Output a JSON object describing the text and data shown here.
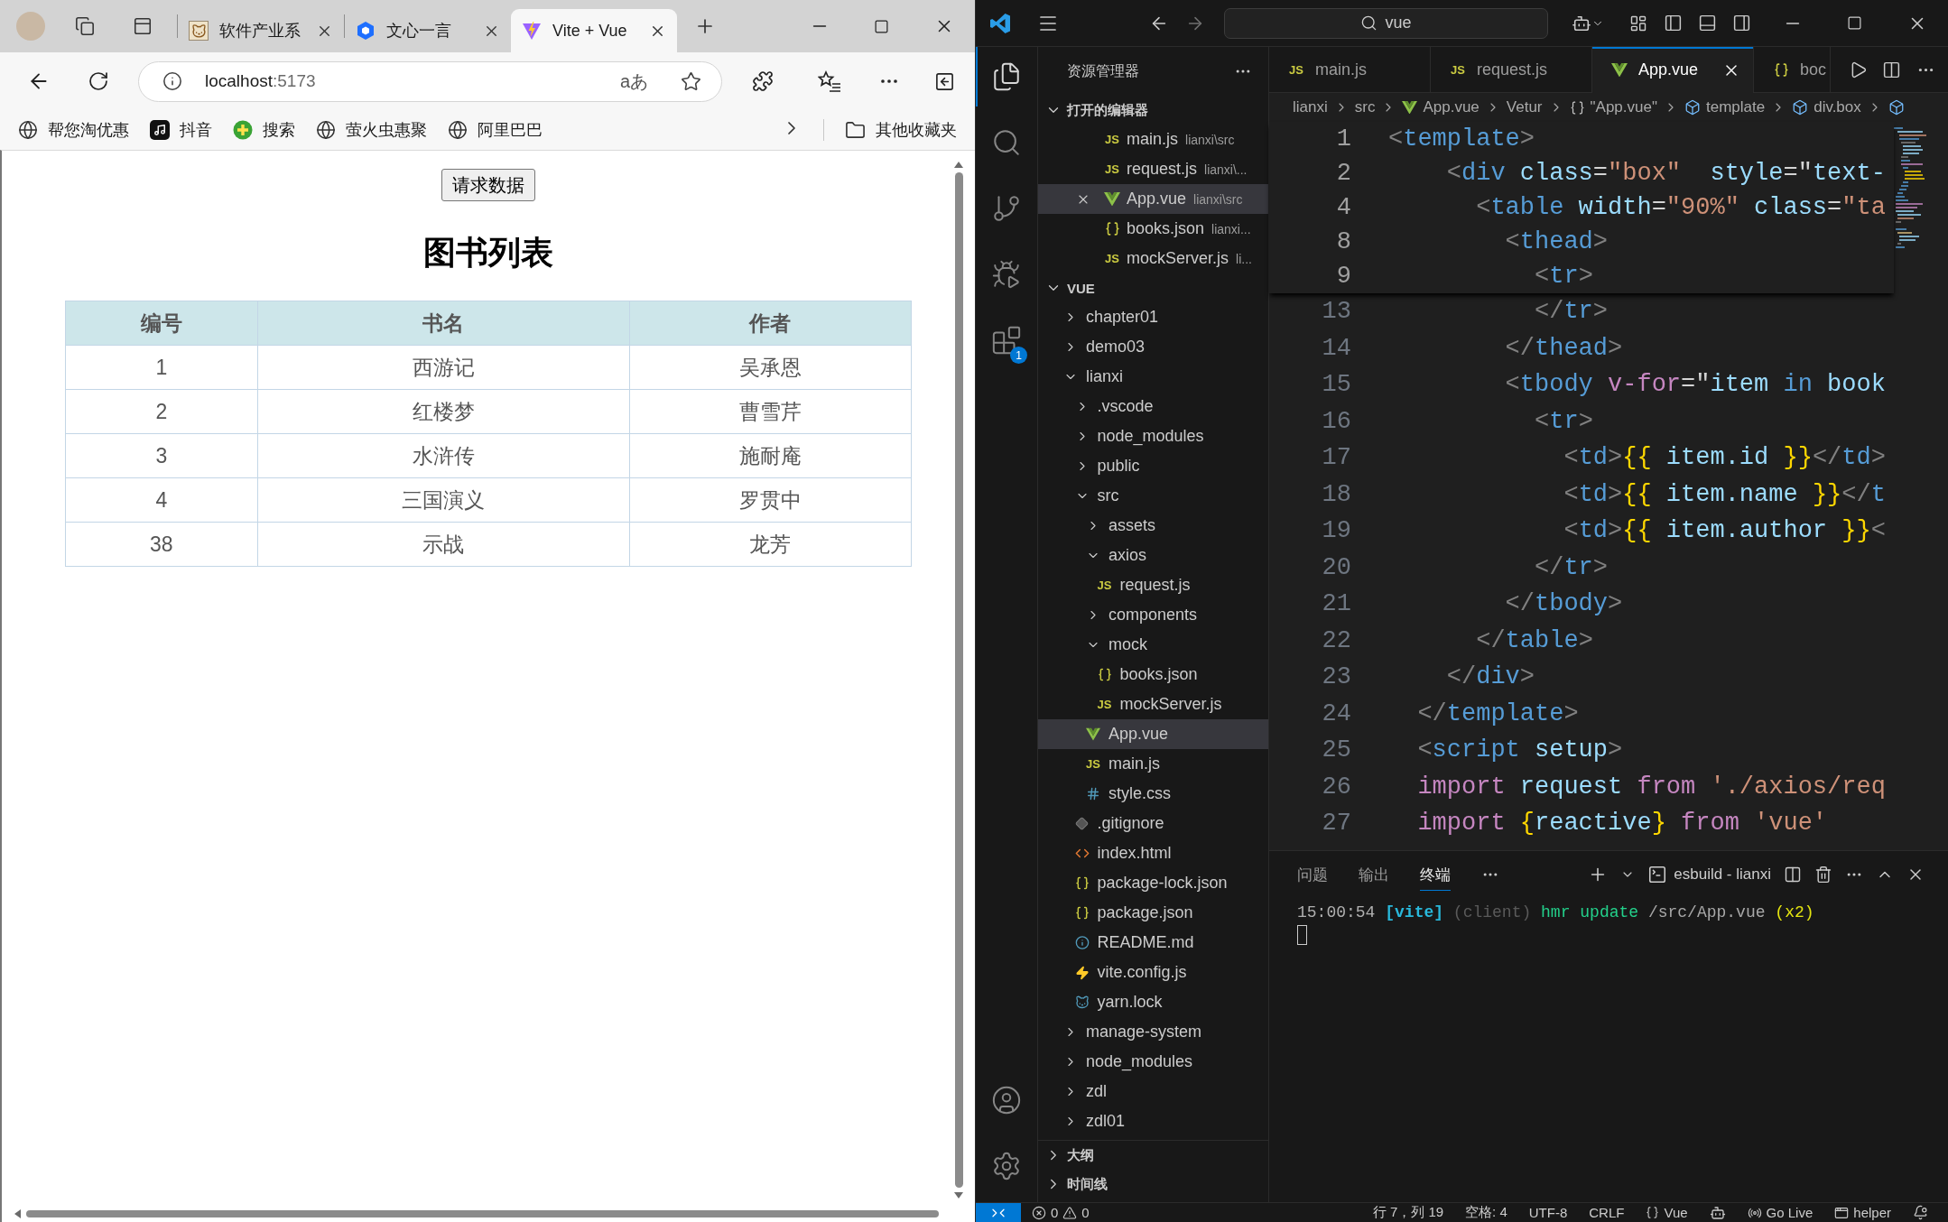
{
  "browser": {
    "tabs": [
      {
        "title": "软件产业系",
        "kind": "cat",
        "selected": false
      },
      {
        "title": "文心一言",
        "kind": "hexagon",
        "selected": false
      },
      {
        "title": "Vite + Vue",
        "kind": "bolt",
        "selected": true
      }
    ],
    "address": {
      "host": "localhost",
      "port": ":5173"
    },
    "reader": "aあ",
    "bookmarks": [
      {
        "label": "帮您淘优惠",
        "kind": "globe"
      },
      {
        "label": "抖音",
        "kind": "note"
      },
      {
        "label": "搜索",
        "kind": "plus"
      },
      {
        "label": "萤火虫惠聚",
        "kind": "globe"
      },
      {
        "label": "阿里巴巴",
        "kind": "globe"
      }
    ],
    "other_bookmarks": "其他收藏夹"
  },
  "page": {
    "button": "请求数据",
    "title": "图书列表",
    "table": {
      "columns": [
        "编号",
        "书名",
        "作者"
      ],
      "rows": [
        [
          "1",
          "西游记",
          "吴承恩"
        ],
        [
          "2",
          "红楼梦",
          "曹雪芹"
        ],
        [
          "3",
          "水浒传",
          "施耐庵"
        ],
        [
          "4",
          "三国演义",
          "罗贯中"
        ],
        [
          "38",
          "示战",
          "龙芳"
        ]
      ]
    }
  },
  "vscode": {
    "search": "vue",
    "activity": [
      {
        "kind": "explorer",
        "selected": true
      },
      {
        "kind": "search",
        "selected": false
      },
      {
        "kind": "source_control",
        "selected": false
      },
      {
        "kind": "run",
        "selected": false
      },
      {
        "kind": "extensions",
        "selected": false,
        "badge": "1"
      }
    ],
    "explorer": {
      "title": "资源管理器",
      "open_editors": {
        "title": "打开的编辑器",
        "expanded": true,
        "items": [
          {
            "name": "main.js",
            "path": "lianxi\\src",
            "kind": "js",
            "icon_text": "JS",
            "selected": false
          },
          {
            "name": "request.js",
            "path": "lianxi\\...",
            "kind": "js",
            "icon_text": "JS",
            "selected": false
          },
          {
            "name": "App.vue",
            "path": "lianxi\\src",
            "kind": "vue",
            "selected": true
          },
          {
            "name": "books.json",
            "path": "lianxi...",
            "kind": "json",
            "selected": false
          },
          {
            "name": "mockServer.js",
            "path": "li...",
            "kind": "js",
            "icon_text": "JS",
            "selected": false
          }
        ]
      },
      "folder": {
        "title": "VUE",
        "expanded": true,
        "children": [
          {
            "name": "chapter01",
            "kind": "folder",
            "expanded": false,
            "selected": false
          },
          {
            "name": "demo03",
            "kind": "folder",
            "expanded": false,
            "selected": false
          },
          {
            "name": "lianxi",
            "kind": "folder",
            "expanded": true,
            "selected": false,
            "children": [
              {
                "name": ".vscode",
                "kind": "folder",
                "expanded": false,
                "selected": false
              },
              {
                "name": "node_modules",
                "kind": "folder",
                "expanded": false,
                "selected": false
              },
              {
                "name": "public",
                "kind": "folder",
                "expanded": false,
                "selected": false
              },
              {
                "name": "src",
                "kind": "folder",
                "expanded": true,
                "selected": false,
                "children": [
                  {
                    "name": "assets",
                    "kind": "folder",
                    "expanded": false,
                    "selected": false
                  },
                  {
                    "name": "axios",
                    "kind": "folder",
                    "expanded": true,
                    "selected": false,
                    "children": [
                      {
                        "name": "request.js",
                        "kind": "js",
                        "icon_text": "JS",
                        "selected": false
                      }
                    ]
                  },
                  {
                    "name": "components",
                    "kind": "folder",
                    "expanded": false,
                    "selected": false
                  },
                  {
                    "name": "mock",
                    "kind": "folder",
                    "expanded": true,
                    "selected": false,
                    "children": [
                      {
                        "name": "books.json",
                        "kind": "json",
                        "selected": false
                      },
                      {
                        "name": "mockServer.js",
                        "kind": "js",
                        "icon_text": "JS",
                        "selected": false
                      }
                    ]
                  },
                  {
                    "name": "App.vue",
                    "kind": "vue",
                    "selected": true
                  },
                  {
                    "name": "main.js",
                    "kind": "js",
                    "icon_text": "JS",
                    "selected": false
                  },
                  {
                    "name": "style.css",
                    "kind": "css",
                    "selected": false
                  }
                ]
              },
              {
                "name": ".gitignore",
                "kind": "git",
                "selected": false
              },
              {
                "name": "index.html",
                "kind": "html",
                "selected": false
              },
              {
                "name": "package-lock.json",
                "kind": "json",
                "selected": false
              },
              {
                "name": "package.json",
                "kind": "json",
                "selected": false
              },
              {
                "name": "README.md",
                "kind": "info",
                "selected": false
              },
              {
                "name": "vite.config.js",
                "kind": "vite",
                "selected": false
              },
              {
                "name": "yarn.lock",
                "kind": "yarn",
                "selected": false
              }
            ]
          },
          {
            "name": "manage-system",
            "kind": "folder",
            "expanded": false,
            "selected": false
          },
          {
            "name": "node_modules",
            "kind": "folder",
            "expanded": false,
            "selected": false
          },
          {
            "name": "zdl",
            "kind": "folder",
            "expanded": false,
            "selected": false
          },
          {
            "name": "zdl01",
            "kind": "folder",
            "expanded": false,
            "selected": false
          }
        ]
      },
      "sections": [
        {
          "title": "大纲",
          "expanded": false
        },
        {
          "title": "时间线",
          "expanded": false
        }
      ]
    },
    "tabs": [
      {
        "label": "main.js",
        "kind": "js",
        "icon_text": "JS",
        "selected": false
      },
      {
        "label": "request.js",
        "kind": "js",
        "icon_text": "JS",
        "selected": false
      },
      {
        "label": "App.vue",
        "kind": "vue",
        "selected": true
      },
      {
        "label": "boc",
        "kind": "json",
        "selected": false
      }
    ],
    "breadcrumbs": [
      {
        "label": "lianxi",
        "kind": "plain"
      },
      {
        "label": "src",
        "kind": "plain"
      },
      {
        "label": "App.vue",
        "kind": "vue"
      },
      {
        "label": "Vetur",
        "kind": "plain"
      },
      {
        "label": "\"App.vue\"",
        "kind": "braces"
      },
      {
        "label": "template",
        "kind": "cube"
      },
      {
        "label": "div.box",
        "kind": "cube"
      },
      {
        "kind": "cube"
      }
    ],
    "sticky_lines": [
      {
        "number": "1",
        "tokens": [
          {
            "text": "<",
            "kind": "punct"
          },
          {
            "text": "template",
            "kind": "tag"
          },
          {
            "text": ">",
            "kind": "punct"
          }
        ]
      },
      {
        "number": "2",
        "tokens": [
          {
            "text": "    <",
            "kind": "punct"
          },
          {
            "text": "div",
            "kind": "tag"
          },
          {
            "text": " class",
            "kind": "attr"
          },
          {
            "text": "=",
            "kind": "op"
          },
          {
            "text": "\"box\"",
            "kind": "str"
          },
          {
            "text": "  style",
            "kind": "attr"
          },
          {
            "text": "=\"",
            "kind": "op"
          },
          {
            "text": "text-",
            "kind": "attr"
          }
        ]
      },
      {
        "number": "4",
        "tokens": [
          {
            "text": "      <",
            "kind": "punct"
          },
          {
            "text": "table",
            "kind": "tag"
          },
          {
            "text": " width",
            "kind": "attr"
          },
          {
            "text": "=",
            "kind": "op"
          },
          {
            "text": "\"90%\"",
            "kind": "str"
          },
          {
            "text": " class",
            "kind": "attr"
          },
          {
            "text": "=",
            "kind": "op"
          },
          {
            "text": "\"ta",
            "kind": "str"
          }
        ]
      },
      {
        "number": "8",
        "tokens": [
          {
            "text": "        <",
            "kind": "punct"
          },
          {
            "text": "thead",
            "kind": "tag"
          },
          {
            "text": ">",
            "kind": "punct"
          }
        ]
      },
      {
        "number": "9",
        "tokens": [
          {
            "text": "          <",
            "kind": "punct"
          },
          {
            "text": "tr",
            "kind": "tag"
          },
          {
            "text": ">",
            "kind": "punct"
          }
        ]
      }
    ],
    "lines": [
      {
        "number": "13",
        "tokens": [
          {
            "text": "          </",
            "kind": "punct"
          },
          {
            "text": "tr",
            "kind": "tag"
          },
          {
            "text": ">",
            "kind": "punct"
          }
        ]
      },
      {
        "number": "14",
        "tokens": [
          {
            "text": "        </",
            "kind": "punct"
          },
          {
            "text": "thead",
            "kind": "tag"
          },
          {
            "text": ">",
            "kind": "punct"
          }
        ]
      },
      {
        "number": "15",
        "tokens": [
          {
            "text": "        <",
            "kind": "punct"
          },
          {
            "text": "tbody",
            "kind": "tag"
          },
          {
            "text": " v-for",
            "kind": "directive"
          },
          {
            "text": "=\"",
            "kind": "op"
          },
          {
            "text": "item",
            "kind": "var"
          },
          {
            "text": " in",
            "kind": "kw"
          },
          {
            "text": " book",
            "kind": "var"
          }
        ]
      },
      {
        "number": "16",
        "tokens": [
          {
            "text": "          <",
            "kind": "punct"
          },
          {
            "text": "tr",
            "kind": "tag"
          },
          {
            "text": ">",
            "kind": "punct"
          }
        ]
      },
      {
        "number": "17",
        "tokens": [
          {
            "text": "            <",
            "kind": "punct"
          },
          {
            "text": "td",
            "kind": "tag"
          },
          {
            "text": ">",
            "kind": "punct"
          },
          {
            "text": "{{",
            "kind": "brace"
          },
          {
            "text": " item.id ",
            "kind": "var"
          },
          {
            "text": "}}",
            "kind": "brace"
          },
          {
            "text": "</",
            "kind": "punct"
          },
          {
            "text": "td",
            "kind": "tag"
          },
          {
            "text": ">",
            "kind": "punct"
          }
        ]
      },
      {
        "number": "18",
        "tokens": [
          {
            "text": "            <",
            "kind": "punct"
          },
          {
            "text": "td",
            "kind": "tag"
          },
          {
            "text": ">",
            "kind": "punct"
          },
          {
            "text": "{{",
            "kind": "brace"
          },
          {
            "text": " item.name ",
            "kind": "var"
          },
          {
            "text": "}}",
            "kind": "brace"
          },
          {
            "text": "</",
            "kind": "punct"
          },
          {
            "text": "t",
            "kind": "tag"
          }
        ]
      },
      {
        "number": "19",
        "tokens": [
          {
            "text": "            <",
            "kind": "punct"
          },
          {
            "text": "td",
            "kind": "tag"
          },
          {
            "text": ">",
            "kind": "punct"
          },
          {
            "text": "{{",
            "kind": "brace"
          },
          {
            "text": " item.author ",
            "kind": "var"
          },
          {
            "text": "}}",
            "kind": "brace"
          },
          {
            "text": "<",
            "kind": "punct"
          }
        ]
      },
      {
        "number": "20",
        "tokens": [
          {
            "text": "          </",
            "kind": "punct"
          },
          {
            "text": "tr",
            "kind": "tag"
          },
          {
            "text": ">",
            "kind": "punct"
          }
        ]
      },
      {
        "number": "21",
        "tokens": [
          {
            "text": "        </",
            "kind": "punct"
          },
          {
            "text": "tbody",
            "kind": "tag"
          },
          {
            "text": ">",
            "kind": "punct"
          }
        ]
      },
      {
        "number": "22",
        "tokens": [
          {
            "text": "      </",
            "kind": "punct"
          },
          {
            "text": "table",
            "kind": "tag"
          },
          {
            "text": ">",
            "kind": "punct"
          }
        ]
      },
      {
        "number": "23",
        "tokens": [
          {
            "text": "    </",
            "kind": "punct"
          },
          {
            "text": "div",
            "kind": "tag"
          },
          {
            "text": ">",
            "kind": "punct"
          }
        ]
      },
      {
        "number": "24",
        "tokens": [
          {
            "text": "  </",
            "kind": "punct"
          },
          {
            "text": "template",
            "kind": "tag"
          },
          {
            "text": ">",
            "kind": "punct"
          }
        ]
      },
      {
        "number": "25",
        "tokens": [
          {
            "text": "  <",
            "kind": "punct"
          },
          {
            "text": "script",
            "kind": "tag"
          },
          {
            "text": " setup",
            "kind": "attr"
          },
          {
            "text": ">",
            "kind": "punct"
          }
        ]
      },
      {
        "number": "26",
        "tokens": [
          {
            "text": "  import",
            "kind": "keyword"
          },
          {
            "text": " request ",
            "kind": "var"
          },
          {
            "text": "from",
            "kind": "keyword"
          },
          {
            "text": " './axios/req",
            "kind": "str"
          }
        ]
      },
      {
        "number": "27",
        "tokens": [
          {
            "text": "  import",
            "kind": "keyword"
          },
          {
            "text": " {",
            "kind": "brace"
          },
          {
            "text": "reactive",
            "kind": "var"
          },
          {
            "text": "}",
            "kind": "brace"
          },
          {
            "text": " from",
            "kind": "keyword"
          },
          {
            "text": " 'vue'",
            "kind": "str"
          }
        ]
      }
    ],
    "panel": {
      "tabs": [
        {
          "label": "问题",
          "selected": false
        },
        {
          "label": "输出",
          "selected": false
        },
        {
          "label": "终端",
          "selected": true
        }
      ],
      "terminal_name": "esbuild - lianxi",
      "terminal_lines": [
        {
          "tokens": [
            {
              "text": "15:00:54",
              "kind": "time"
            },
            {
              "text": " [vite]",
              "kind": "source"
            },
            {
              "text": " (client)",
              "kind": "dim"
            },
            {
              "text": " hmr update",
              "kind": "action"
            },
            {
              "text": " /src/App.vue",
              "kind": "path"
            },
            {
              "text": " (x2)",
              "kind": "count"
            }
          ]
        }
      ]
    },
    "status_bar": {
      "errors": "0",
      "warnings": "0",
      "items": [
        {
          "kind": "text",
          "label": "行 7，列 19"
        },
        {
          "kind": "text",
          "label": "空格: 4"
        },
        {
          "kind": "text",
          "label": "UTF-8"
        },
        {
          "kind": "text",
          "label": "CRLF"
        },
        {
          "kind": "language",
          "label": "Vue"
        },
        {
          "kind": "copilot"
        },
        {
          "kind": "live",
          "label": "Go Live"
        },
        {
          "kind": "helper",
          "label": "helper"
        },
        {
          "kind": "bell"
        }
      ]
    }
  }
}
